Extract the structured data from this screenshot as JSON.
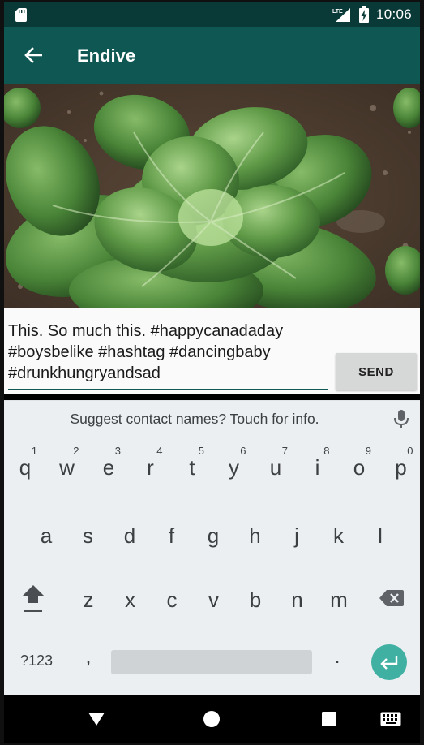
{
  "status_bar": {
    "time": "10:06",
    "network": "LTE",
    "icons": [
      "sd-card-icon",
      "lte-signal-icon",
      "battery-charging-icon"
    ]
  },
  "app_bar": {
    "title": "Endive",
    "back_icon": "arrow-back-icon"
  },
  "photo": {
    "subject": "endive-lettuce-photo"
  },
  "compose": {
    "message_text": "This. So much this. #happycanadaday #boysbelike #hashtag #dancingbaby #drunkhungryandsad",
    "send_label": "SEND",
    "accent_color": "#0e5753"
  },
  "keyboard": {
    "suggestion": "Suggest contact names? Touch for info.",
    "row1": [
      {
        "key": "q",
        "hint": "1"
      },
      {
        "key": "w",
        "hint": "2"
      },
      {
        "key": "e",
        "hint": "3"
      },
      {
        "key": "r",
        "hint": "4"
      },
      {
        "key": "t",
        "hint": "5"
      },
      {
        "key": "y",
        "hint": "6"
      },
      {
        "key": "u",
        "hint": "7"
      },
      {
        "key": "i",
        "hint": "8"
      },
      {
        "key": "o",
        "hint": "9"
      },
      {
        "key": "p",
        "hint": "0"
      }
    ],
    "row2": [
      "a",
      "s",
      "d",
      "f",
      "g",
      "h",
      "j",
      "k",
      "l"
    ],
    "row3": [
      "z",
      "x",
      "c",
      "v",
      "b",
      "n",
      "m"
    ],
    "symbols_label": "?123",
    "comma_label": ",",
    "period_label": ".",
    "enter_color": "#40b0a3"
  },
  "nav_bar": {
    "icons": [
      "nav-back-icon",
      "nav-home-icon",
      "nav-recents-icon",
      "keyboard-switch-icon"
    ]
  }
}
